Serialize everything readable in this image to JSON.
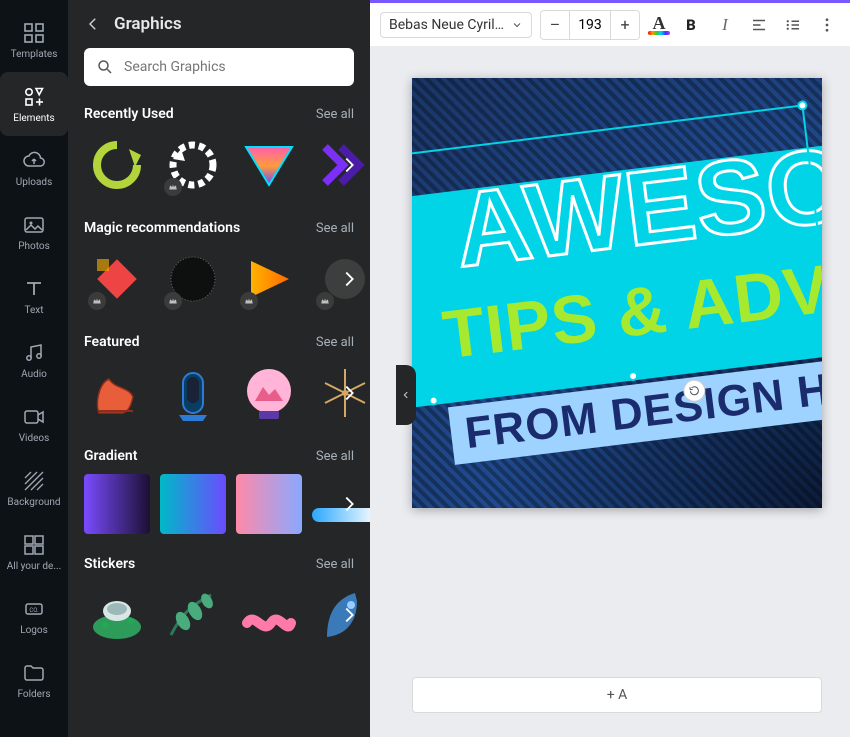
{
  "rail": [
    {
      "id": "templates",
      "label": "Templates"
    },
    {
      "id": "elements",
      "label": "Elements"
    },
    {
      "id": "uploads",
      "label": "Uploads"
    },
    {
      "id": "photos",
      "label": "Photos"
    },
    {
      "id": "text",
      "label": "Text"
    },
    {
      "id": "audio",
      "label": "Audio"
    },
    {
      "id": "videos",
      "label": "Videos"
    },
    {
      "id": "background",
      "label": "Background"
    },
    {
      "id": "allyourde",
      "label": "All your de..."
    },
    {
      "id": "logos",
      "label": "Logos"
    },
    {
      "id": "folders",
      "label": "Folders"
    }
  ],
  "panel": {
    "title": "Graphics",
    "search_placeholder": "Search Graphics",
    "see_all": "See all",
    "sections": {
      "recently_used": "Recently Used",
      "magic": "Magic recommendations",
      "featured": "Featured",
      "gradient": "Gradient",
      "stickers": "Stickers"
    }
  },
  "toolbar": {
    "font_name": "Bebas Neue Cyril...",
    "font_size": "193",
    "minus": "–",
    "plus": "+",
    "text_color_letter": "A",
    "bold": "B",
    "italic": "I"
  },
  "design": {
    "text1": "AWESO",
    "text2": "TIPS & ADV",
    "banner": "FROM DESIGN H"
  },
  "add_page": "+ A"
}
